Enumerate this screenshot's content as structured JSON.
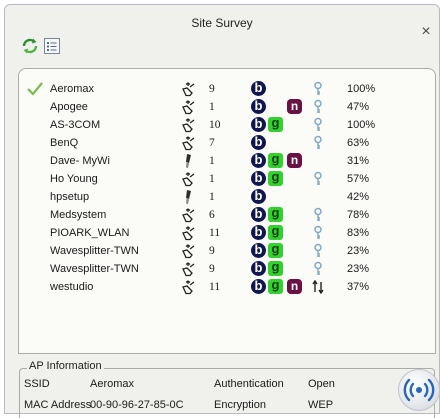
{
  "window": {
    "title": "Site Survey"
  },
  "networks": [
    {
      "ssid": "Aeromax",
      "mode": "infrastructure",
      "channel": "9",
      "b": true,
      "g": false,
      "n": false,
      "signal": "100%",
      "key_icon": true,
      "wps_icon": false,
      "connected": true
    },
    {
      "ssid": "Apogee",
      "mode": "infrastructure",
      "channel": "1",
      "b": true,
      "g": false,
      "n": true,
      "signal": "47%",
      "key_icon": true,
      "wps_icon": false,
      "connected": false
    },
    {
      "ssid": "AS-3COM",
      "mode": "infrastructure",
      "channel": "10",
      "b": true,
      "g": true,
      "n": false,
      "signal": "100%",
      "key_icon": true,
      "wps_icon": false,
      "connected": false
    },
    {
      "ssid": "BenQ",
      "mode": "infrastructure",
      "channel": "7",
      "b": true,
      "g": false,
      "n": false,
      "signal": "63%",
      "key_icon": true,
      "wps_icon": false,
      "connected": false
    },
    {
      "ssid": "Dave- MyWi",
      "mode": "adhoc",
      "channel": "1",
      "b": true,
      "g": true,
      "n": true,
      "signal": "31%",
      "key_icon": false,
      "wps_icon": false,
      "connected": false
    },
    {
      "ssid": "Ho Young",
      "mode": "infrastructure",
      "channel": "1",
      "b": true,
      "g": true,
      "n": false,
      "signal": "57%",
      "key_icon": true,
      "wps_icon": false,
      "connected": false
    },
    {
      "ssid": "hpsetup",
      "mode": "adhoc",
      "channel": "1",
      "b": true,
      "g": false,
      "n": false,
      "signal": "42%",
      "key_icon": false,
      "wps_icon": false,
      "connected": false
    },
    {
      "ssid": "Medsystem",
      "mode": "infrastructure",
      "channel": "6",
      "b": true,
      "g": true,
      "n": false,
      "signal": "78%",
      "key_icon": true,
      "wps_icon": false,
      "connected": false
    },
    {
      "ssid": "PIOARK_WLAN",
      "mode": "infrastructure",
      "channel": "11",
      "b": true,
      "g": true,
      "n": false,
      "signal": "83%",
      "key_icon": true,
      "wps_icon": false,
      "connected": false
    },
    {
      "ssid": "Wavesplitter-TWN",
      "mode": "infrastructure",
      "channel": "9",
      "b": true,
      "g": true,
      "n": false,
      "signal": "23%",
      "key_icon": true,
      "wps_icon": false,
      "connected": false
    },
    {
      "ssid": "Wavesplitter-TWN",
      "mode": "infrastructure",
      "channel": "9",
      "b": true,
      "g": true,
      "n": false,
      "signal": "23%",
      "key_icon": true,
      "wps_icon": false,
      "connected": false
    },
    {
      "ssid": "westudio",
      "mode": "infrastructure",
      "channel": "11",
      "b": true,
      "g": true,
      "n": true,
      "signal": "37%",
      "key_icon": false,
      "wps_icon": true,
      "connected": false
    }
  ],
  "ap_info": {
    "legend": "AP Information",
    "ssid_label": "SSID",
    "ssid_value": "Aeromax",
    "mac_label": "MAC Address",
    "mac_value": "00-90-96-27-85-0C",
    "auth_label": "Authentication",
    "auth_value": "Open",
    "enc_label": "Encryption",
    "enc_value": "WEP"
  },
  "colors": {
    "b_badge": "#0f1650",
    "g_badge": "#33d12d",
    "n_badge": "#6a1144"
  }
}
